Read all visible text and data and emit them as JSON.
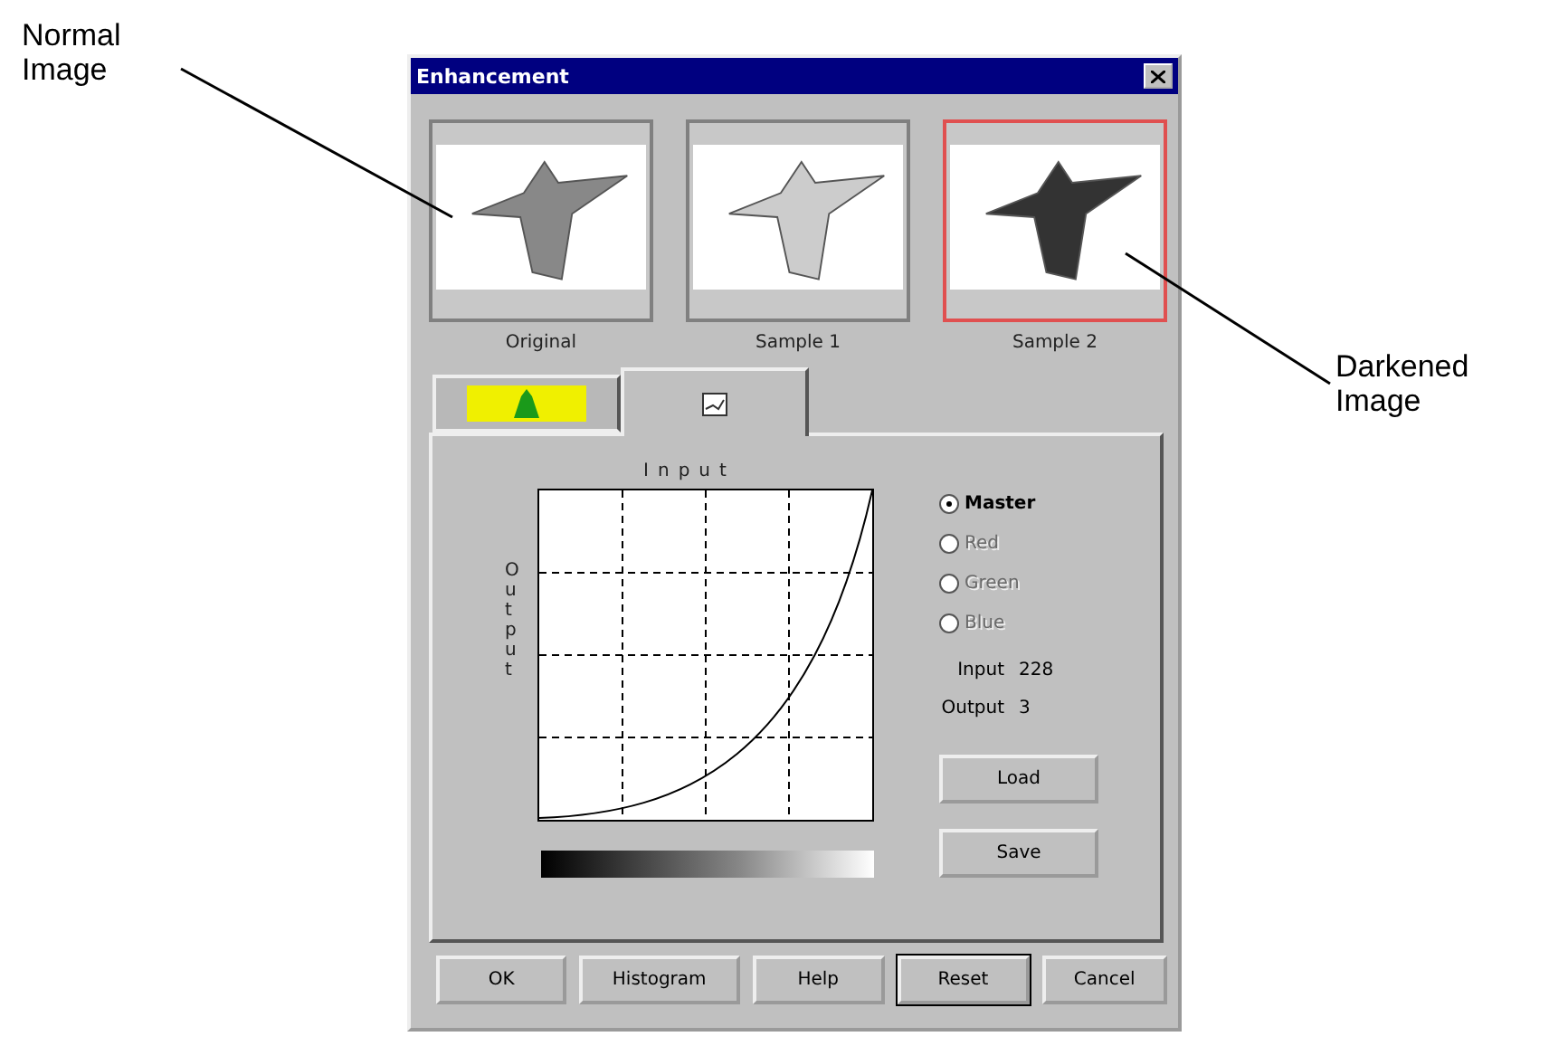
{
  "callouts": [
    {
      "text": "Normal Image",
      "kind": "left"
    },
    {
      "text": "Darkened Image",
      "kind": "right"
    }
  ],
  "window": {
    "title": "Enhancement"
  },
  "samples": [
    {
      "label": "Original",
      "kind": "normal",
      "selected": false
    },
    {
      "label": "Sample 1",
      "kind": "light",
      "selected": false
    },
    {
      "label": "Sample 2",
      "kind": "dark",
      "selected": true
    }
  ],
  "tabs": [
    {
      "kind": "color",
      "selected": false
    },
    {
      "kind": "curve",
      "selected": true
    }
  ],
  "curve": {
    "xlabel": "Input",
    "ylabel": "Output"
  },
  "channels": [
    {
      "label": "Master",
      "selected": true,
      "disabled": false
    },
    {
      "label": "Red",
      "selected": false,
      "disabled": true
    },
    {
      "label": "Green",
      "selected": false,
      "disabled": true
    },
    {
      "label": "Blue",
      "selected": false,
      "disabled": true
    }
  ],
  "readouts": [
    {
      "label": "Input",
      "value": "228"
    },
    {
      "label": "Output",
      "value": "3"
    }
  ],
  "side_buttons": [
    "Load",
    "Save"
  ],
  "buttons": [
    {
      "label": "OK",
      "default": false
    },
    {
      "label": "Histogram",
      "default": false
    },
    {
      "label": "Help",
      "default": false
    },
    {
      "label": "Reset",
      "default": true
    },
    {
      "label": "Cancel",
      "default": false
    }
  ]
}
